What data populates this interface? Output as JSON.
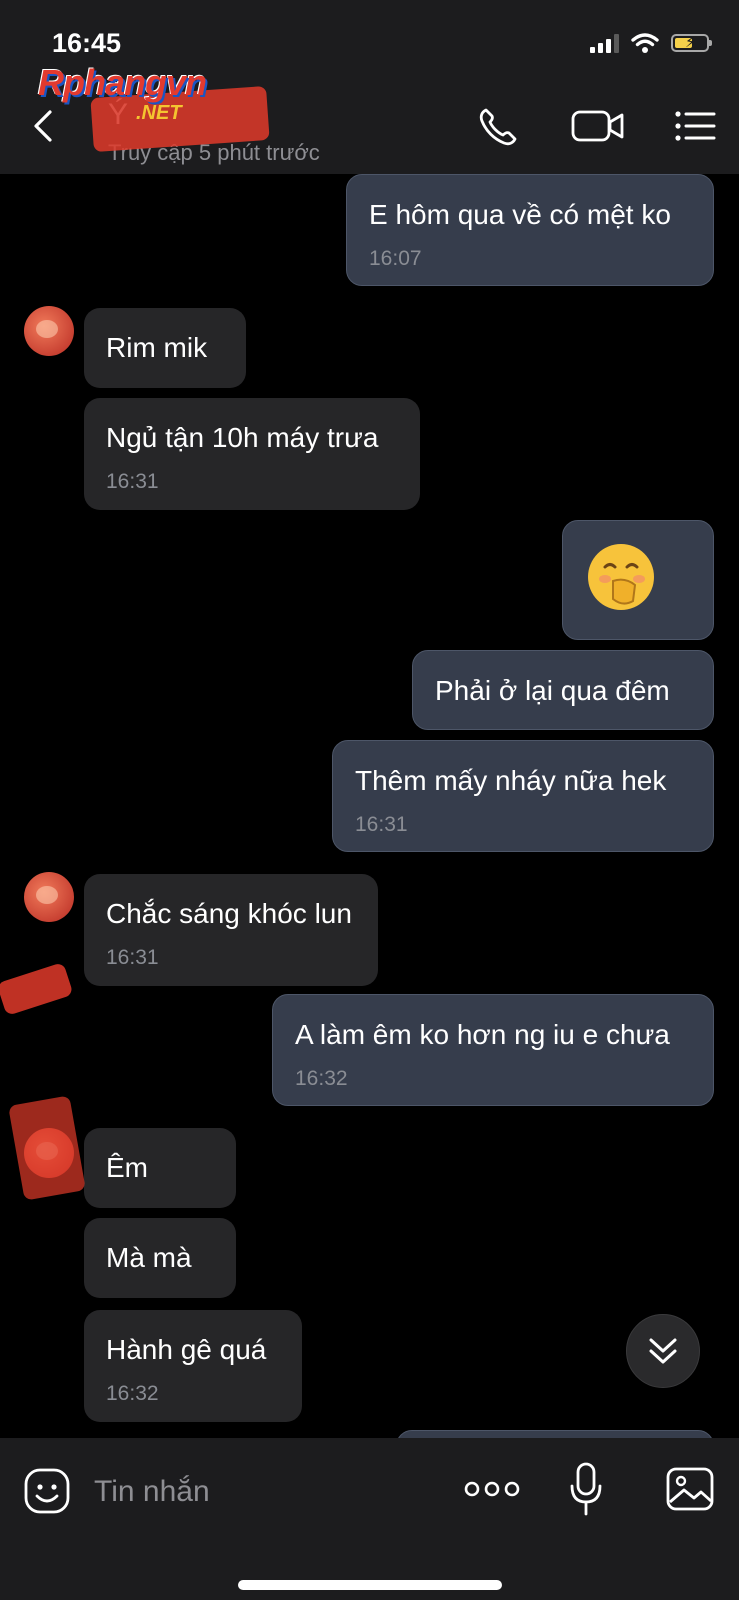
{
  "status_bar": {
    "time": "16:45",
    "battery_level": 0.55,
    "battery_color": "#f5d04a"
  },
  "watermark": {
    "main": "Rphangvn",
    "suffix": ".NET"
  },
  "header": {
    "contact_name": "Ý",
    "contact_status": "Truy cập 5 phút trước",
    "icons": [
      "back-icon",
      "phone-icon",
      "video-camera-icon",
      "menu-icon"
    ]
  },
  "messages": [
    {
      "direction": "out",
      "text": "E hôm qua về có mệt ko",
      "time": "16:07"
    },
    {
      "direction": "in",
      "text": "Rim mik"
    },
    {
      "direction": "in",
      "text": "Ngủ tận 10h máy trưa",
      "time": "16:31"
    },
    {
      "direction": "out",
      "emoji": "hand-over-mouth-emoji"
    },
    {
      "direction": "out",
      "text": "Phải ở lại qua đêm"
    },
    {
      "direction": "out",
      "text": "Thêm mấy nháy nữa hek",
      "time": "16:31"
    },
    {
      "direction": "in",
      "text": "Chắc sáng khóc lun",
      "time": "16:31"
    },
    {
      "direction": "out",
      "text": "A làm êm ko hơn ng iu e chưa",
      "time": "16:32"
    },
    {
      "direction": "in",
      "text": "Êm"
    },
    {
      "direction": "in",
      "text": "Mà mà"
    },
    {
      "direction": "in",
      "text": "Hành gê quá",
      "time": "16:32"
    }
  ],
  "input_bar": {
    "placeholder": "Tin nhắn",
    "icons": [
      "sticker-icon",
      "more-options-icon",
      "microphone-icon",
      "image-icon"
    ]
  },
  "colors": {
    "background": "#000000",
    "bar": "#1c1c1e",
    "outgoing_bubble": "#363d4c",
    "incoming_bubble": "#262628"
  }
}
